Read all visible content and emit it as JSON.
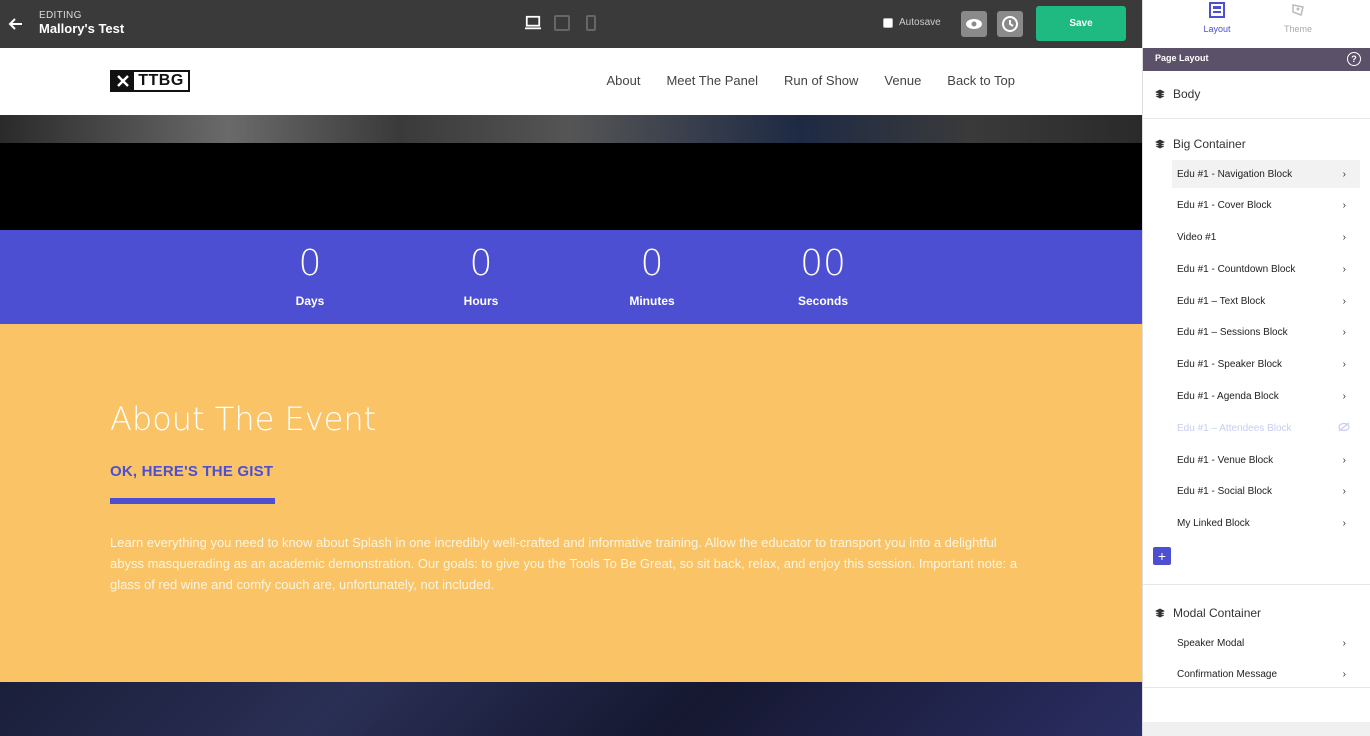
{
  "topbar": {
    "editing_label": "EDITING",
    "title": "Mallory's Test",
    "autosave_label": "Autosave",
    "save_label": "Save"
  },
  "site": {
    "logo_text": "TTBG",
    "nav": [
      "About",
      "Meet The Panel",
      "Run of Show",
      "Venue",
      "Back to Top"
    ]
  },
  "countdown": {
    "units": [
      {
        "value": "0",
        "label": "Days"
      },
      {
        "value": "0",
        "label": "Hours"
      },
      {
        "value": "0",
        "label": "Minutes"
      },
      {
        "value": "00",
        "label": "Seconds"
      }
    ]
  },
  "about": {
    "title": "About The Event",
    "subtitle": "OK, HERE'S THE GIST",
    "body": "Learn everything you need to know about Splash in one incredibly well-crafted and informative training. Allow the educator to transport you into a delightful abyss masquerading as an academic demonstration. Our goals: to give you the Tools To Be Great, so sit back, relax, and enjoy this session. Important note: a glass of red wine and comfy couch are, unfortunately, not included."
  },
  "panel": {
    "tabs": {
      "layout": "Layout",
      "theme": "Theme"
    },
    "header": "Page Layout",
    "help": "?",
    "body_label": "Body",
    "big_container_label": "Big Container",
    "items": [
      "Edu #1 - Navigation Block",
      "Edu #1 - Cover Block",
      "Video #1",
      "Edu #1 - Countdown Block",
      "Edu #1 – Text Block",
      "Edu #1 – Sessions Block",
      "Edu #1 - Speaker Block",
      "Edu #1 - Agenda Block",
      "Edu #1 – Attendees Block",
      "Edu #1 - Venue Block",
      "Edu #1 - Social Block",
      "My Linked Block"
    ],
    "modal_container_label": "Modal Container",
    "modal_items": [
      "Speaker Modal",
      "Confirmation Message"
    ],
    "add_label": "+"
  },
  "colors": {
    "accent": "#4d4fd2",
    "save": "#1fb982",
    "about_bg": "#f9c366",
    "topbar": "#3a3a3a"
  }
}
